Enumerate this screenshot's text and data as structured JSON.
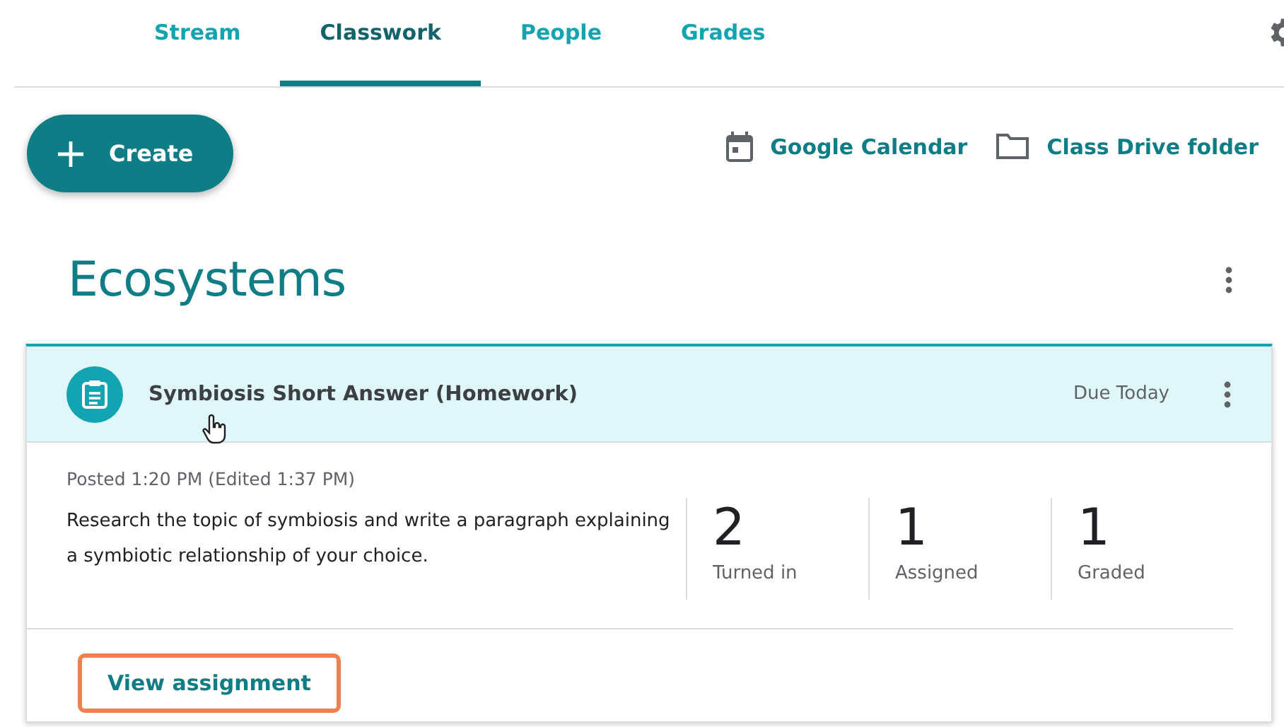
{
  "tabs": [
    {
      "label": "Stream",
      "selected": false
    },
    {
      "label": "Classwork",
      "selected": true
    },
    {
      "label": "People",
      "selected": false
    },
    {
      "label": "Grades",
      "selected": false
    }
  ],
  "create_button": {
    "label": "Create"
  },
  "links": [
    {
      "kind": "calendar",
      "label": "Google Calendar"
    },
    {
      "kind": "folder",
      "label": "Class Drive folder"
    }
  ],
  "topic": {
    "title": "Ecosystems"
  },
  "assignment": {
    "title": "Symbiosis Short Answer (Homework)",
    "due": "Due Today",
    "expanded": true,
    "posted": "Posted 1:20 PM (Edited 1:37 PM)",
    "description": "Research the topic of symbiosis and write a paragraph explaining a symbiotic relationship of your choice.",
    "stats": [
      {
        "value": "2",
        "label": "Turned in"
      },
      {
        "value": "1",
        "label": "Assigned"
      },
      {
        "value": "1",
        "label": "Graded"
      }
    ],
    "view_link": {
      "label": "View assignment",
      "highlighted": true
    }
  }
}
